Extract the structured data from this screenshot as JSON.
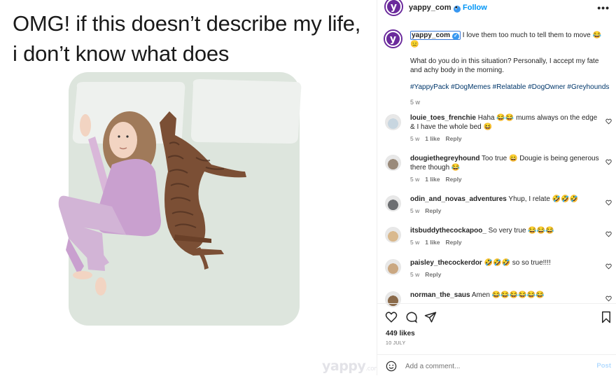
{
  "meme": {
    "line1": "OMG! if this doesn’t describe my life,",
    "line2": "i don’t know what does",
    "watermark": "yappy",
    "watermark_suffix": ".com"
  },
  "header": {
    "username": "yappy_com",
    "verified": "✓",
    "dot": "•",
    "follow_label": "Follow",
    "more_label": "•••",
    "avatar_letter": "y"
  },
  "caption": {
    "username": "yappy_com",
    "text1": " I love them too much to tell them to move 😂😑",
    "text2": "What do you do in this situation? Personally, I accept my fate and achy body in the morning.",
    "hashtags": "#YappyPack #DogMemes #Relatable #DogOwner #Greyhounds",
    "time": "5 w"
  },
  "comments": [
    {
      "username": "louie_toes_frenchie",
      "text": " Haha 😂😂 mums always on the edge & I have the whole bed 😆",
      "time": "5 w",
      "likes": "1 like",
      "reply": "Reply",
      "avatar_color": "#c8d6e0"
    },
    {
      "username": "dougiethegreyhound",
      "text": " Too true 😄 Dougie is being generous there though 😂",
      "time": "5 w",
      "likes": "1 like",
      "reply": "Reply",
      "avatar_color": "#9a8a7a"
    },
    {
      "username": "odin_and_novas_adventures",
      "text": " Yhup, I relate 🤣🤣🤣",
      "time": "5 w",
      "likes": "",
      "reply": "Reply",
      "avatar_color": "#6d6f72"
    },
    {
      "username": "itsbuddythecockapoo_",
      "text": " So very true 😂😂😂",
      "time": "5 w",
      "likes": "1 like",
      "reply": "Reply",
      "avatar_color": "#d9b98e"
    },
    {
      "username": "paisley_thecockerdor",
      "text": " 🤣🤣🤣 so so true!!!!",
      "time": "5 w",
      "likes": "",
      "reply": "Reply",
      "avatar_color": "#caa882"
    },
    {
      "username": "norman_the_saus",
      "text": " Amen 😂😂😂😂😂😂",
      "time": "",
      "likes": "",
      "reply": "",
      "avatar_color": "#8a6a4a"
    }
  ],
  "actions": {
    "likes": "449 likes",
    "date": "10 JULY",
    "comment_placeholder": "Add a comment...",
    "post_label": "Post"
  },
  "colors": {
    "brand": "#6b2a9c",
    "link": "#0095f6",
    "hashtag": "#00376b"
  }
}
